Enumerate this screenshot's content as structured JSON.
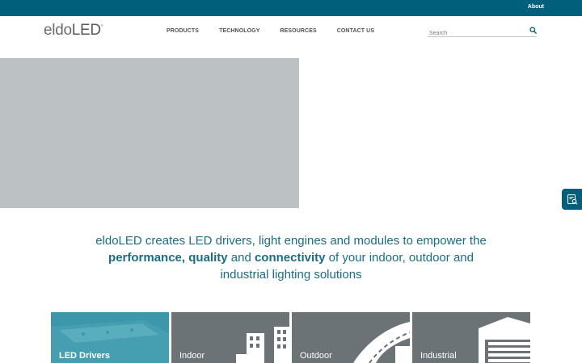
{
  "topbar": {
    "about_label": "About"
  },
  "header": {
    "logo": {
      "eldo": "eldo",
      "led": "LED",
      "mark": "®"
    },
    "nav": [
      {
        "label": "PRODUCTS"
      },
      {
        "label": "TECHNOLOGY"
      },
      {
        "label": "RESOURCES"
      },
      {
        "label": "CONTACT US"
      }
    ],
    "search": {
      "placeholder": "Search",
      "icon": "search-icon"
    }
  },
  "side_tab": {
    "icon": "catalog-search-icon"
  },
  "tagline": {
    "part1": "eldoLED creates LED drivers, light engines and modules to empower the",
    "bold1": "performance",
    "sep1": ",",
    "bold2": "quality",
    "and1": "and",
    "bold3": "connectivity",
    "part2": "of your indoor, outdoor and",
    "part3": "industrial lighting solutions"
  },
  "tiles": [
    {
      "label": "LED Drivers"
    },
    {
      "label": "Indoor"
    },
    {
      "label": "Outdoor"
    },
    {
      "label": "Industrial"
    }
  ],
  "colors": {
    "brand": "#005f7b",
    "tagline": "#1b6d85",
    "hero_placeholder": "#bcc1c4",
    "tile_drivers": "#3b97a9",
    "tile_gray": "#6b7377"
  }
}
